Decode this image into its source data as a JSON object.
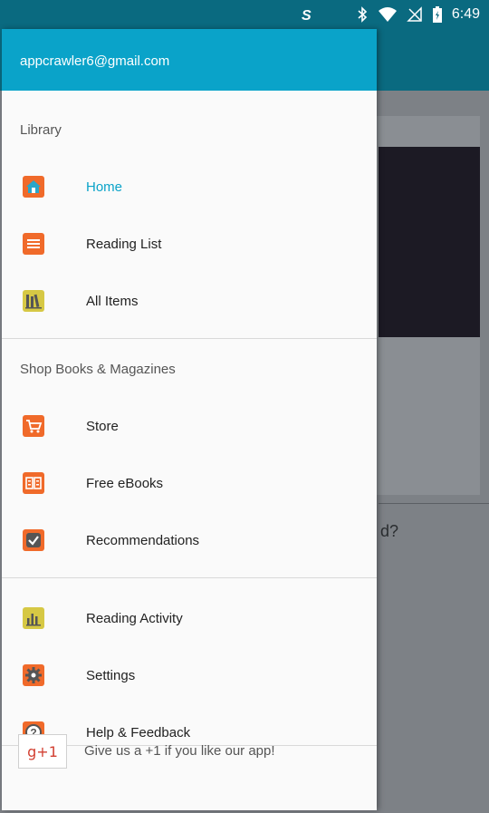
{
  "status_bar": {
    "time": "6:49",
    "icons": [
      "s-app-icon",
      "bluetooth-icon",
      "wifi-icon",
      "no-signal-icon",
      "battery-icon"
    ]
  },
  "background": {
    "partial_text": "d?"
  },
  "drawer": {
    "account_email": "appcrawler6@gmail.com",
    "section_library": "Library",
    "library_items": [
      {
        "label": "Home",
        "icon": "home-icon"
      },
      {
        "label": "Reading List",
        "icon": "list-icon"
      },
      {
        "label": "All Items",
        "icon": "books-icon"
      }
    ],
    "section_shop": "Shop Books & Magazines",
    "shop_items": [
      {
        "label": "Store",
        "icon": "cart-icon"
      },
      {
        "label": "Free eBooks",
        "icon": "ebook-icon"
      },
      {
        "label": "Recommendations",
        "icon": "check-icon"
      }
    ],
    "misc_items": [
      {
        "label": "Reading Activity",
        "icon": "bar-chart-icon"
      },
      {
        "label": "Settings",
        "icon": "gear-icon"
      },
      {
        "label": "Help & Feedback",
        "icon": "help-icon"
      }
    ],
    "gplus_badge": "g+1",
    "gplus_label": "Give us a +1 if you like our app!"
  },
  "colors": {
    "header": "#0aa3c9",
    "status_bar": "#0a6a80",
    "icon_orange": "#f06a2a",
    "active_text": "#0aa3c9"
  }
}
